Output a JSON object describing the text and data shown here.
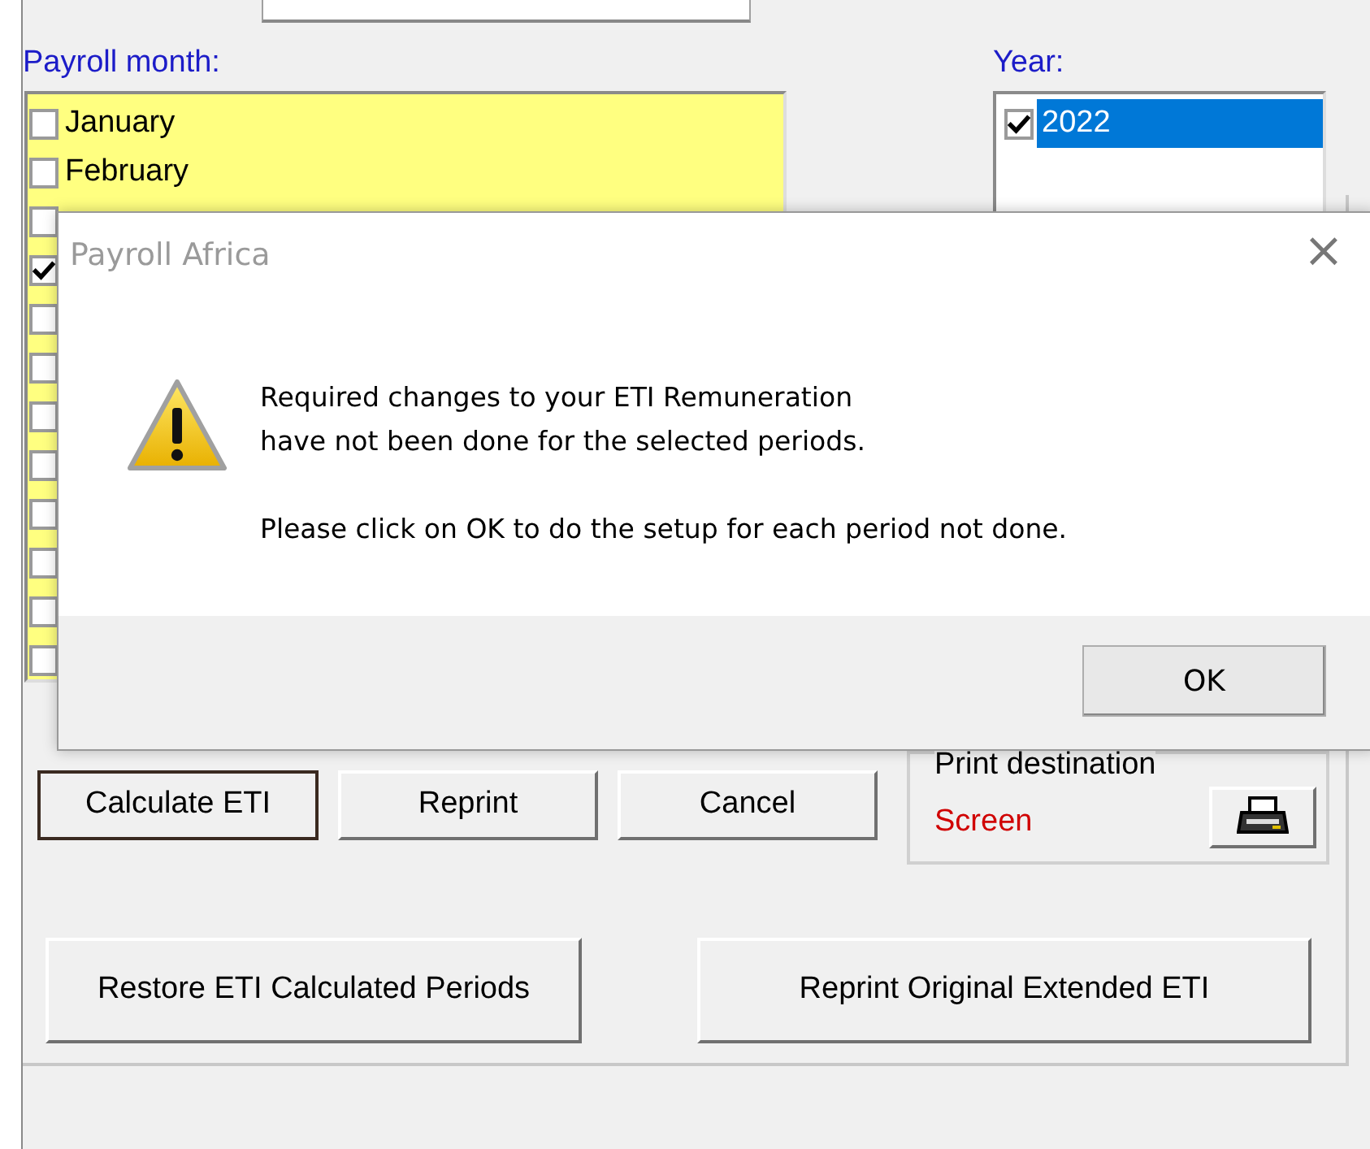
{
  "payroll_month": {
    "label": "Payroll month:",
    "months": [
      {
        "label": "January",
        "checked": false
      },
      {
        "label": "February",
        "checked": false
      },
      {
        "checked": false
      },
      {
        "checked": true
      },
      {
        "checked": false
      },
      {
        "checked": false
      },
      {
        "checked": false
      },
      {
        "checked": false
      },
      {
        "checked": false
      },
      {
        "checked": false
      },
      {
        "checked": false
      },
      {
        "checked": false
      }
    ]
  },
  "year": {
    "label": "Year:",
    "items": [
      {
        "label": "2022",
        "checked": true,
        "selected": true
      }
    ]
  },
  "actions": [
    {
      "label": "Calculate ETI",
      "default": true
    },
    {
      "label": "Reprint",
      "default": false
    },
    {
      "label": "Cancel",
      "default": false
    }
  ],
  "print_destination": {
    "label": "Print destination",
    "value": "Screen"
  },
  "extra_buttons": [
    "Restore ETI Calculated Periods",
    "Reprint Original Extended ETI"
  ],
  "dialog": {
    "title": "Payroll Africa",
    "close": "×",
    "message": [
      "Required changes to your ETI Remuneration",
      "have not been done for the selected periods.",
      "Please click on OK to do the setup for each period not done."
    ],
    "button": "OK"
  }
}
